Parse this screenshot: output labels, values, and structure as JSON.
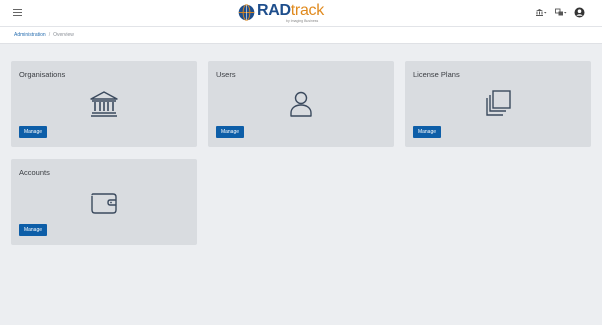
{
  "header": {
    "menu_icon": "hamburger-icon",
    "logo": {
      "text_main": "RAD",
      "text_accent": "track",
      "tagline": "by Imaging Business"
    },
    "icons": [
      "institution-dropdown-icon",
      "language-dropdown-icon",
      "user-account-icon"
    ]
  },
  "breadcrumb": {
    "items": [
      "Administration"
    ],
    "separator": "/",
    "current": "Overview"
  },
  "cards": [
    {
      "title": "Organisations",
      "icon": "bank-icon",
      "button": "Manage"
    },
    {
      "title": "Users",
      "icon": "user-icon",
      "button": "Manage"
    },
    {
      "title": "License Plans",
      "icon": "copy-icon",
      "button": "Manage"
    },
    {
      "title": "Accounts",
      "icon": "wallet-icon",
      "button": "Manage"
    }
  ],
  "colors": {
    "brand_blue": "#1e4e8c",
    "brand_orange": "#e08a1e",
    "button": "#0d5ea8",
    "card_bg": "#d9dce0",
    "page_bg": "#eceef1"
  }
}
